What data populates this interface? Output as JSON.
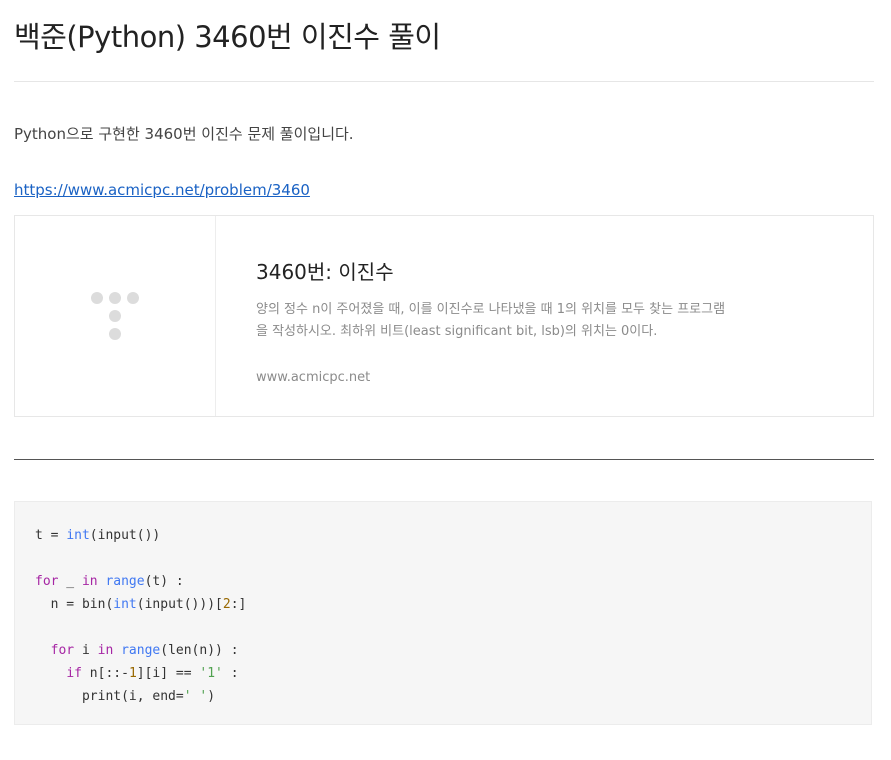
{
  "post": {
    "title": "백준(Python) 3460번 이진수 풀이",
    "intro": "Python으로 구현한 3460번 이진수 문제 풀이입니다.",
    "link": "https://www.acmicpc.net/problem/3460"
  },
  "link_card": {
    "thumbnail_icon": "placeholder-dots-icon",
    "title": "3460번: 이진수",
    "description": "양의 정수 n이 주어졌을 때, 이를 이진수로 나타냈을 때 1의 위치를 모두 찾는 프로그램을 작성하시오. 최하위 비트(least significant bit, lsb)의 위치는 0이다.",
    "domain": "www.acmicpc.net"
  },
  "code": {
    "language": "python",
    "lines": [
      "t = int(input())",
      "",
      "for _ in range(t) :",
      "  n = bin(int(input()))[2:]",
      "",
      "  for i in range(len(n)) :",
      "    if n[::-1][i] == '1' :",
      "      print(i, end=' ')"
    ]
  },
  "colors": {
    "link": "#1a62c4",
    "keyword": "#a626a4",
    "builtin": "#4078f2",
    "number": "#986801",
    "string": "#50a14f",
    "code_background": "#f6f6f6"
  }
}
